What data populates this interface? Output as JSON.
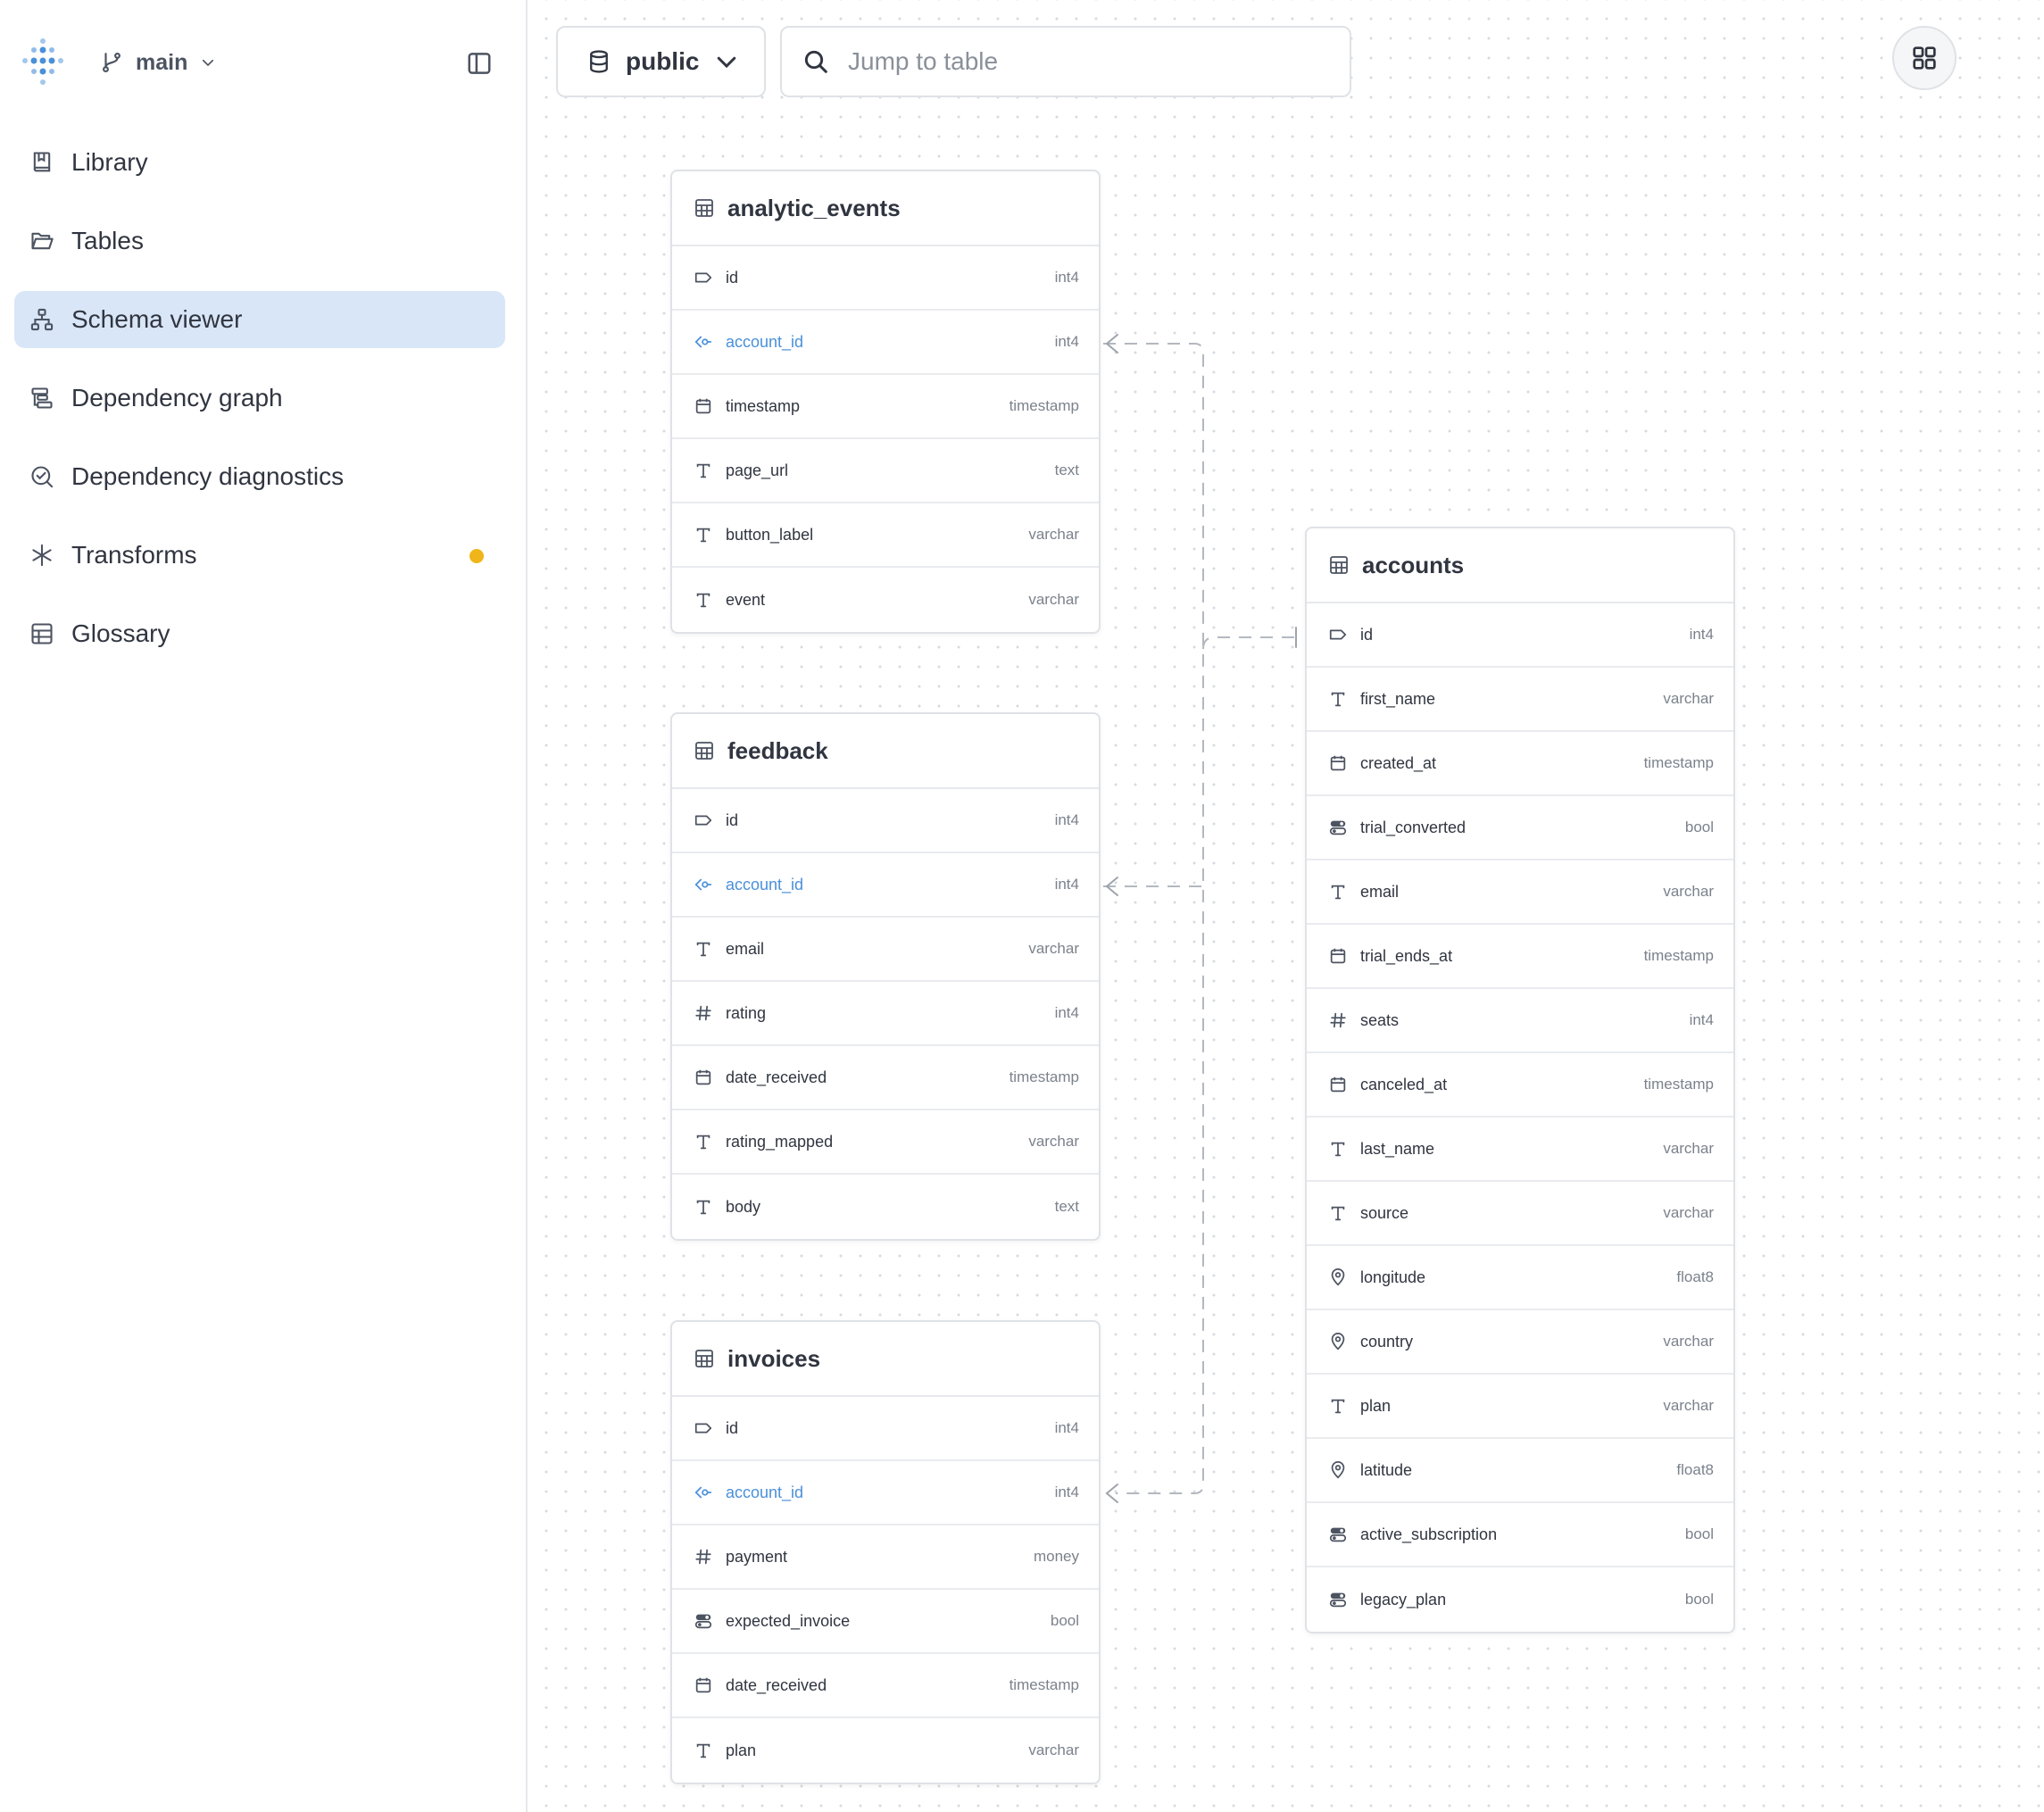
{
  "branch": {
    "name": "main"
  },
  "nav": [
    {
      "label": "Library",
      "icon": "book-icon"
    },
    {
      "label": "Tables",
      "icon": "folder-open-icon"
    },
    {
      "label": "Schema viewer",
      "icon": "schema-icon",
      "active": true
    },
    {
      "label": "Dependency graph",
      "icon": "dependency-graph-icon"
    },
    {
      "label": "Dependency diagnostics",
      "icon": "diagnostics-icon"
    },
    {
      "label": "Transforms",
      "icon": "asterisk-icon",
      "badge_color": "#f0b518"
    },
    {
      "label": "Glossary",
      "icon": "table-grid-icon"
    }
  ],
  "toolbar": {
    "schema": "public",
    "search_placeholder": "Jump to table"
  },
  "colors": {
    "accent": "#4a90d9",
    "active_nav": "#d9e6f7",
    "badge": "#f0b518"
  },
  "tables": [
    {
      "name": "analytic_events",
      "columns": [
        {
          "name": "id",
          "type": "int4",
          "icon": "key-tag-icon"
        },
        {
          "name": "account_id",
          "type": "int4",
          "icon": "foreign-key-icon",
          "fk": true
        },
        {
          "name": "timestamp",
          "type": "timestamp",
          "icon": "calendar-icon"
        },
        {
          "name": "page_url",
          "type": "text",
          "icon": "text-icon"
        },
        {
          "name": "button_label",
          "type": "varchar",
          "icon": "text-icon"
        },
        {
          "name": "event",
          "type": "varchar",
          "icon": "text-icon"
        }
      ]
    },
    {
      "name": "feedback",
      "columns": [
        {
          "name": "id",
          "type": "int4",
          "icon": "key-tag-icon"
        },
        {
          "name": "account_id",
          "type": "int4",
          "icon": "foreign-key-icon",
          "fk": true
        },
        {
          "name": "email",
          "type": "varchar",
          "icon": "text-icon"
        },
        {
          "name": "rating",
          "type": "int4",
          "icon": "hash-icon"
        },
        {
          "name": "date_received",
          "type": "timestamp",
          "icon": "calendar-icon"
        },
        {
          "name": "rating_mapped",
          "type": "varchar",
          "icon": "text-icon"
        },
        {
          "name": "body",
          "type": "text",
          "icon": "text-icon"
        }
      ]
    },
    {
      "name": "invoices",
      "columns": [
        {
          "name": "id",
          "type": "int4",
          "icon": "key-tag-icon"
        },
        {
          "name": "account_id",
          "type": "int4",
          "icon": "foreign-key-icon",
          "fk": true
        },
        {
          "name": "payment",
          "type": "money",
          "icon": "hash-icon"
        },
        {
          "name": "expected_invoice",
          "type": "bool",
          "icon": "toggle-icon"
        },
        {
          "name": "date_received",
          "type": "timestamp",
          "icon": "calendar-icon"
        },
        {
          "name": "plan",
          "type": "varchar",
          "icon": "text-icon"
        }
      ]
    },
    {
      "name": "accounts",
      "columns": [
        {
          "name": "id",
          "type": "int4",
          "icon": "key-tag-icon"
        },
        {
          "name": "first_name",
          "type": "varchar",
          "icon": "text-icon"
        },
        {
          "name": "created_at",
          "type": "timestamp",
          "icon": "calendar-icon"
        },
        {
          "name": "trial_converted",
          "type": "bool",
          "icon": "toggle-icon"
        },
        {
          "name": "email",
          "type": "varchar",
          "icon": "text-icon"
        },
        {
          "name": "trial_ends_at",
          "type": "timestamp",
          "icon": "calendar-icon"
        },
        {
          "name": "seats",
          "type": "int4",
          "icon": "hash-icon"
        },
        {
          "name": "canceled_at",
          "type": "timestamp",
          "icon": "calendar-icon"
        },
        {
          "name": "last_name",
          "type": "varchar",
          "icon": "text-icon"
        },
        {
          "name": "source",
          "type": "varchar",
          "icon": "text-icon"
        },
        {
          "name": "longitude",
          "type": "float8",
          "icon": "location-pin-icon"
        },
        {
          "name": "country",
          "type": "varchar",
          "icon": "location-pin-icon"
        },
        {
          "name": "plan",
          "type": "varchar",
          "icon": "text-icon"
        },
        {
          "name": "latitude",
          "type": "float8",
          "icon": "location-pin-icon"
        },
        {
          "name": "active_subscription",
          "type": "bool",
          "icon": "toggle-icon"
        },
        {
          "name": "legacy_plan",
          "type": "bool",
          "icon": "toggle-icon"
        }
      ]
    }
  ]
}
